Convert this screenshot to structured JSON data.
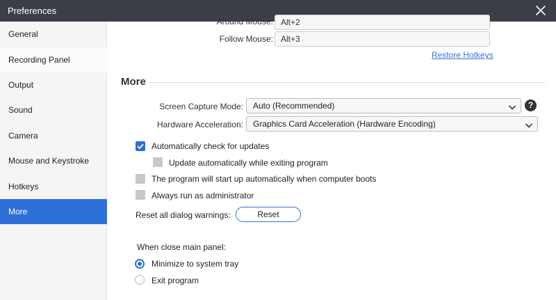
{
  "window": {
    "title": "Preferences"
  },
  "sidebar": {
    "items": [
      {
        "label": "General"
      },
      {
        "label": "Recording Panel"
      },
      {
        "label": "Output"
      },
      {
        "label": "Sound"
      },
      {
        "label": "Camera"
      },
      {
        "label": "Mouse and Keystroke"
      },
      {
        "label": "Hotkeys"
      },
      {
        "label": "More"
      }
    ],
    "active": "More"
  },
  "hotkeys": {
    "around_mouse": {
      "label": "Around Mouse:",
      "value": "Alt+2"
    },
    "follow_mouse": {
      "label": "Follow Mouse:",
      "value": "Alt+3"
    },
    "restore_link": "Restore Hotkeys"
  },
  "more": {
    "title": "More",
    "screen_capture_mode": {
      "label": "Screen Capture Mode:",
      "value": "Auto (Recommended)",
      "help": "?"
    },
    "hardware_acceleration": {
      "label": "Hardware Acceleration:",
      "value": "Graphics Card Acceleration (Hardware Encoding)"
    },
    "options": {
      "auto_check_updates": {
        "label": "Automatically check for updates",
        "checked": true
      },
      "update_on_exit": {
        "label": "Update automatically while exiting program",
        "checked": false
      },
      "start_on_boot": {
        "label": "The program will start up automatically when computer boots",
        "checked": false
      },
      "run_as_admin": {
        "label": "Always run as administrator",
        "checked": false
      }
    },
    "reset_warnings": {
      "label": "Reset all dialog warnings:",
      "button": "Reset"
    },
    "close_panel": {
      "label": "When close main panel:",
      "options": [
        {
          "label": "Minimize to system tray",
          "selected": true
        },
        {
          "label": "Exit program",
          "selected": false
        }
      ]
    }
  },
  "colors": {
    "titlebar": "#3b3f45",
    "accent": "#2c6fd6",
    "link": "#3a6fd8",
    "sidebar_bg": "#f5f5f5"
  }
}
